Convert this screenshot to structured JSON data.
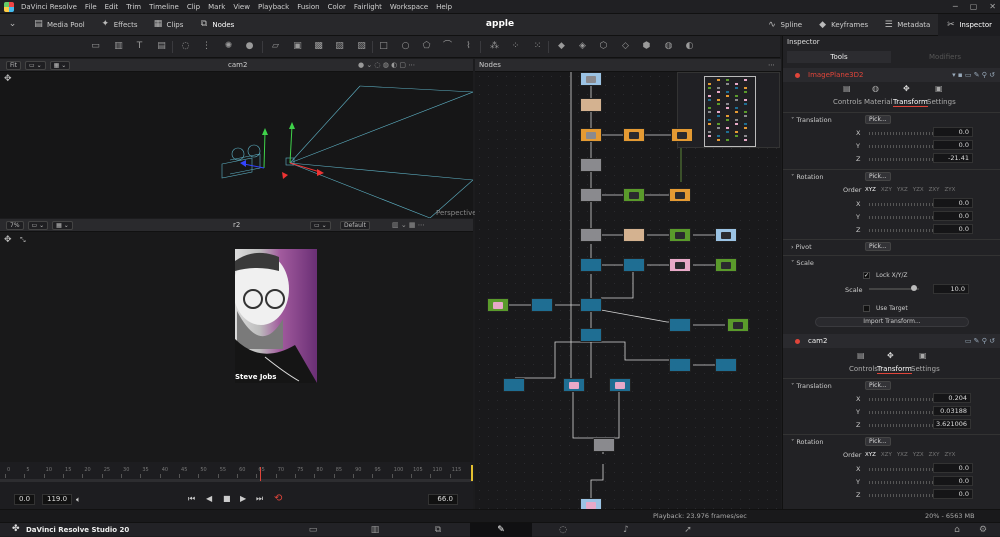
{
  "menubar": {
    "app_name": "DaVinci Resolve",
    "items": [
      "File",
      "Edit",
      "Trim",
      "Timeline",
      "Clip",
      "Mark",
      "View",
      "Playback",
      "Fusion",
      "Color",
      "Fairlight",
      "Workspace",
      "Help"
    ]
  },
  "toolbar": {
    "media_pool": "Media Pool",
    "effects": "Effects",
    "clips": "Clips",
    "nodes": "Nodes",
    "project_title": "apple",
    "spline": "Spline",
    "keyframes": "Keyframes",
    "metadata": "Metadata",
    "inspector": "Inspector"
  },
  "viewer_top": {
    "zoom": "Fit",
    "name": "cam2",
    "label": "Perspective"
  },
  "viewer_bottom": {
    "zoom": "7%",
    "name": "r2",
    "lut": "Default",
    "caption": "Steve Jobs"
  },
  "nodes_panel": {
    "title": "Nodes"
  },
  "timeline": {
    "ticks": [
      "0",
      "5",
      "10",
      "15",
      "20",
      "25",
      "30",
      "35",
      "40",
      "45",
      "50",
      "55",
      "60",
      "65",
      "70",
      "75",
      "80",
      "85",
      "90",
      "95",
      "100",
      "105",
      "110",
      "115"
    ],
    "start": "0.0",
    "end": "119.0",
    "current": "66.0"
  },
  "inspector": {
    "title": "Inspector",
    "tab_tools": "Tools",
    "tab_modifiers": "Modifiers",
    "tool1": {
      "name": "ImagePlane3D2",
      "tabs": [
        "Controls",
        "Material",
        "Transform",
        "Settings"
      ],
      "active_tab": "Transform",
      "translation": {
        "label": "Translation",
        "pick": "Pick...",
        "x": "0.0",
        "y": "0.0",
        "z": "-21.41"
      },
      "rotation": {
        "label": "Rotation",
        "order_label": "Order",
        "orders": [
          "XYZ",
          "XZY",
          "YXZ",
          "YZX",
          "ZXY",
          "ZYX"
        ],
        "pick": "Pick...",
        "x": "0.0",
        "y": "0.0",
        "z": "0.0"
      },
      "pivot": {
        "label": "Pivot",
        "pick": "Pick..."
      },
      "scale": {
        "label": "Scale",
        "lock": "Lock X/Y/Z",
        "scale_label": "Scale",
        "value": "10.0",
        "use_target": "Use Target",
        "import": "Import Transform..."
      }
    },
    "tool2": {
      "name": "cam2",
      "tabs": [
        "Controls",
        "Transform",
        "Settings"
      ],
      "active_tab": "Transform",
      "translation": {
        "label": "Translation",
        "pick": "Pick...",
        "x": "0.204",
        "y": "0.03188",
        "z": "3.621006"
      },
      "rotation": {
        "label": "Rotation",
        "order_label": "Order",
        "orders": [
          "XYZ",
          "XZY",
          "YXZ",
          "YZX",
          "ZXY",
          "ZYX"
        ],
        "pick": "Pick...",
        "x": "0.0",
        "y": "0.0",
        "z": "0.0"
      }
    }
  },
  "status": {
    "playback": "Playback: 23.976 frames/sec",
    "memory": "20% - 6563 MB"
  },
  "bottombar": {
    "app": "DaVinci Resolve Studio 20"
  },
  "colors": {
    "accent_red": "#e0453a",
    "node_blue": "#1f6e93",
    "node_orange": "#e49a33",
    "node_green": "#5a9a2b",
    "playhead": "#e0453a"
  }
}
